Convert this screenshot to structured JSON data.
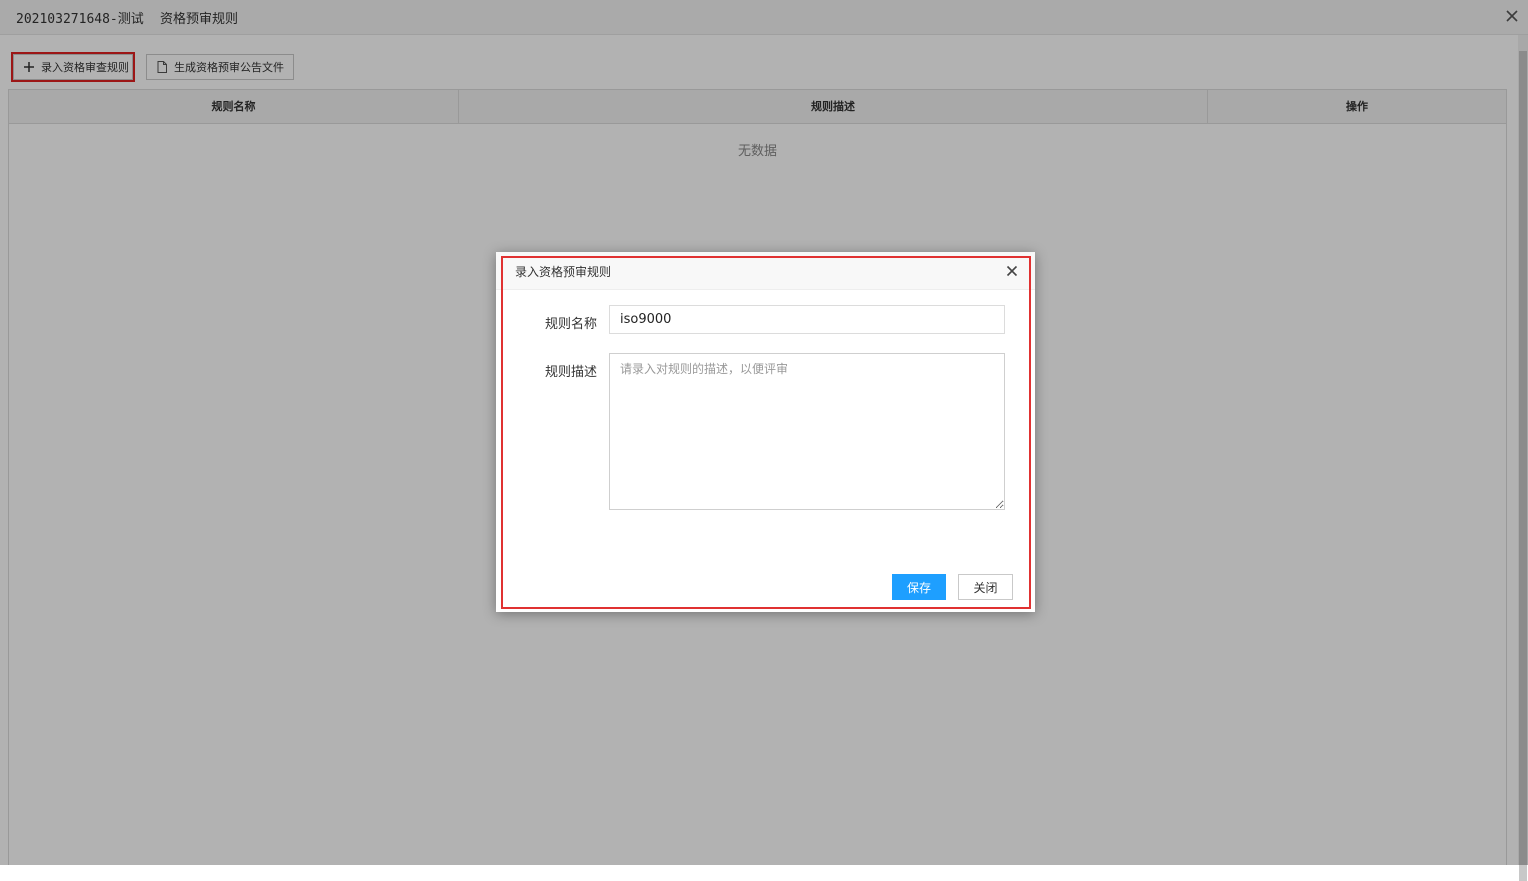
{
  "header": {
    "project": "202103271648-测试",
    "title": "资格预审规则"
  },
  "toolbar": {
    "add_label": "录入资格审查规则",
    "generate_label": "生成资格预审公告文件"
  },
  "table": {
    "columns": [
      "规则名称",
      "规则描述",
      "操作"
    ],
    "empty_text": "无数据"
  },
  "modal": {
    "title": "录入资格预审规则",
    "name_label": "规则名称",
    "name_value": "iso9000",
    "desc_label": "规则描述",
    "desc_placeholder": "请录入对规则的描述，以便评审",
    "save_label": "保存",
    "close_label": "关闭"
  },
  "colors": {
    "primary": "#1e9fff",
    "highlight": "#e03131",
    "overlay": "rgba(0,0,0,0.30)"
  },
  "icons": {
    "header_close": "close-icon",
    "add": "plus-icon",
    "generate": "document-icon",
    "modal_close": "close-icon"
  }
}
